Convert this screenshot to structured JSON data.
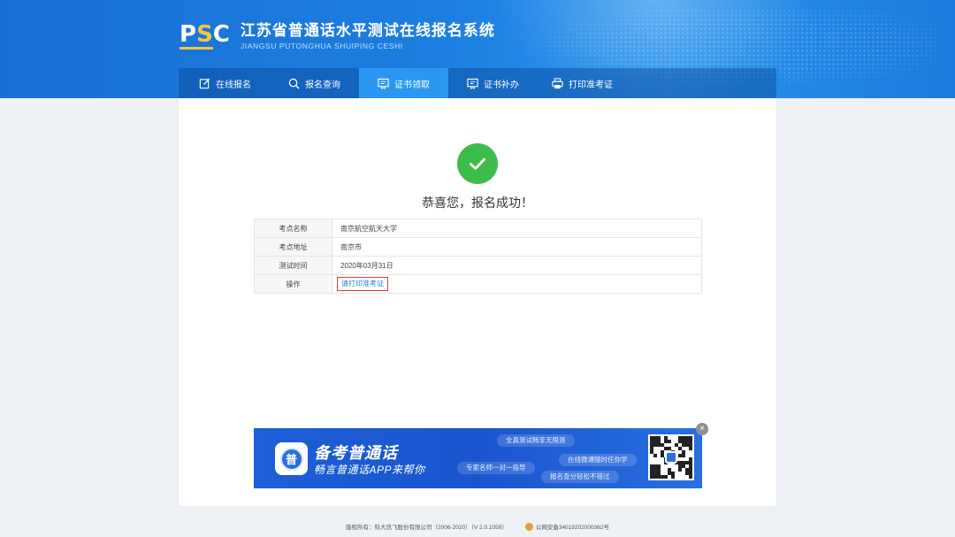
{
  "header": {
    "logo_mark_p": "P",
    "logo_mark_s": "S",
    "logo_mark_c": "C",
    "title": "江苏省普通话水平测试在线报名系统",
    "subtitle": "JIANGSU PUTONGHUA SHUIPING CESHI"
  },
  "nav": [
    {
      "label": "在线报名",
      "icon": "edit-icon"
    },
    {
      "label": "报名查询",
      "icon": "search-icon"
    },
    {
      "label": "证书领取",
      "icon": "certificate-icon",
      "active": true
    },
    {
      "label": "证书补办",
      "icon": "certificate-reissue-icon"
    },
    {
      "label": "打印准考证",
      "icon": "printer-icon"
    }
  ],
  "result": {
    "message": "恭喜您，报名成功！"
  },
  "info": {
    "rows": [
      {
        "key": "考点名称",
        "value": "南京航空航天大学"
      },
      {
        "key": "考点地址",
        "value": "南京市"
      },
      {
        "key": "测试时间",
        "value": "2020年03月31日"
      },
      {
        "key": "操作",
        "value": ""
      }
    ],
    "action_link": "请打印准考证"
  },
  "banner": {
    "app_glyph": "普",
    "title": "备考普通话",
    "subtitle": "畅言普通话APP来帮你",
    "pills": [
      "全真测试畅享无限测",
      "专家名师一对一指导",
      "在线微课随时任你学",
      "报名查分轻松不错过"
    ],
    "close": "×"
  },
  "footer": {
    "copyright": "版权所有：科大讯飞股份有限公司（2006-2020）（V 2.0.1059）",
    "police": "公网安备34019202000362号"
  },
  "colors": {
    "header_blue": "#1c7ee0",
    "nav_active": "#2a98f0",
    "success_green": "#3ebc4a",
    "link_blue": "#2a7fe0",
    "highlight_red": "#e83a3a"
  }
}
